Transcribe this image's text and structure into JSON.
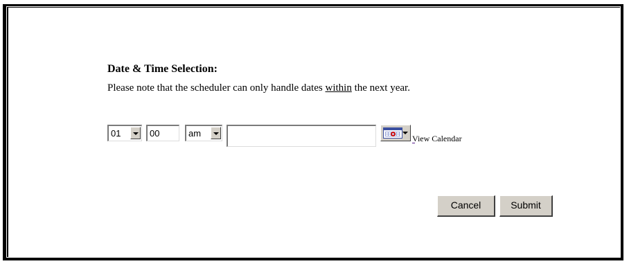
{
  "section": {
    "title": "Date & Time Selection:",
    "note_before": "Please note that the scheduler can only handle dates ",
    "note_emphasis": "within",
    "note_after": " the next year."
  },
  "time": {
    "hour": "01",
    "minute": "00",
    "meridiem": "am"
  },
  "date": {
    "value": ""
  },
  "calendar": {
    "icon": "calendar-icon",
    "link_label": "View Calendar"
  },
  "actions": {
    "cancel_label": "Cancel",
    "submit_label": "Submit"
  }
}
